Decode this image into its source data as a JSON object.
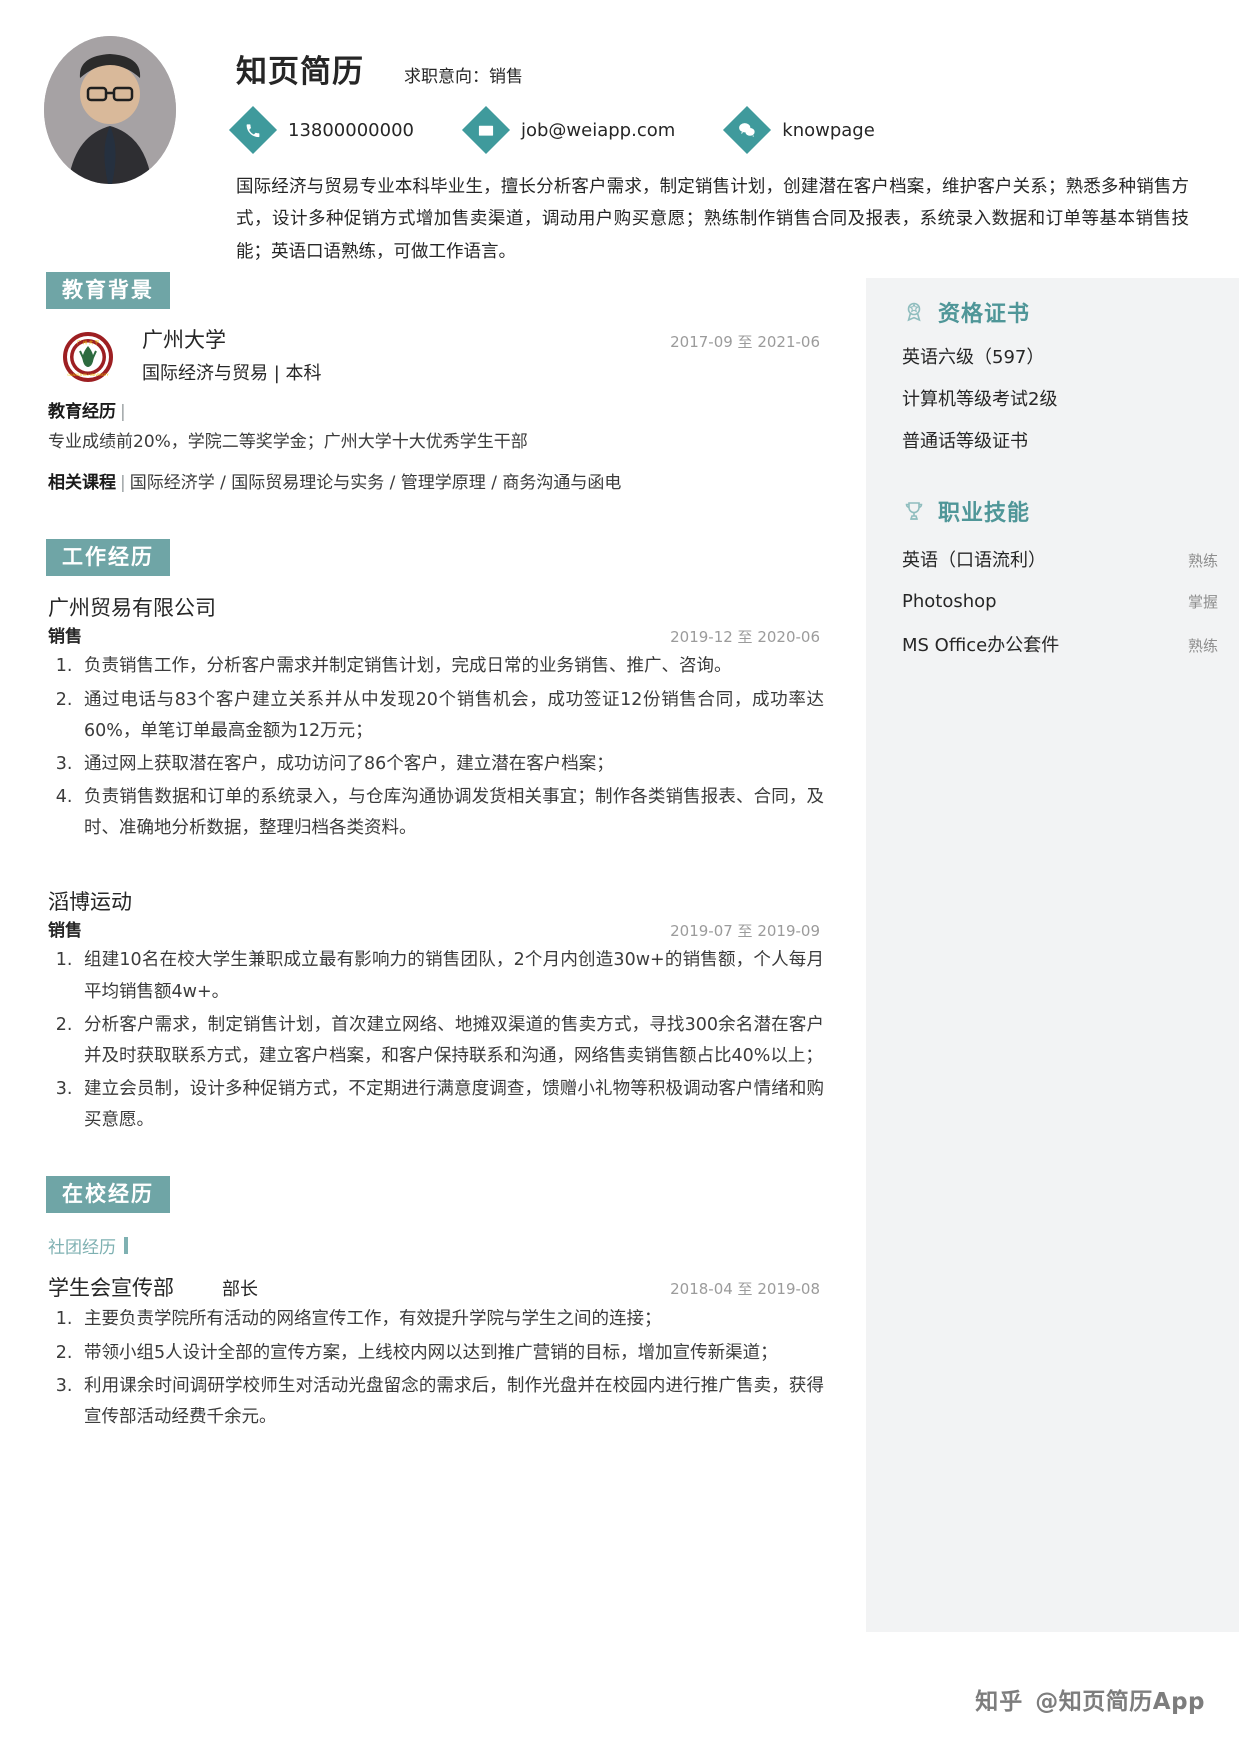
{
  "header": {
    "name": "知页简历",
    "objective": "求职意向：销售",
    "contacts": [
      {
        "icon": "phone-icon",
        "text": "13800000000"
      },
      {
        "icon": "mail-icon",
        "text": "job@weiapp.com"
      },
      {
        "icon": "wechat-icon",
        "text": "knowpage"
      }
    ],
    "summary": "国际经济与贸易专业本科毕业生，擅长分析客户需求，制定销售计划，创建潜在客户档案，维护客户关系；熟悉多种销售方式，设计多种促销方式增加售卖渠道，调动用户购买意愿；熟练制作销售合同及报表，系统录入数据和订单等基本销售技能；英语口语熟练，可做工作语言。"
  },
  "education": {
    "section_title": "教育背景",
    "school": "广州大学",
    "major": "国际经济与贸易 | 本科",
    "date": "2017-09 至 2021-06",
    "experience_label": "教育经历",
    "experience_text": "专业成绩前20%，学院二等奖学金；广州大学十大优秀学生干部",
    "courses_label": "相关课程",
    "courses_text": "国际经济学 / 国际贸易理论与实务 / 管理学原理 / 商务沟通与函电"
  },
  "work": {
    "section_title": "工作经历",
    "jobs": [
      {
        "company": "广州贸易有限公司",
        "role": "销售",
        "date": "2019-12 至 2020-06",
        "bullets": [
          "负责销售工作，分析客户需求并制定销售计划，完成日常的业务销售、推广、咨询。",
          "通过电话与83个客户建立关系并从中发现20个销售机会，成功签证12份销售合同，成功率达60%，单笔订单最高金额为12万元；",
          "通过网上获取潜在客户，成功访问了86个客户，建立潜在客户档案；",
          "负责销售数据和订单的系统录入，与仓库沟通协调发货相关事宜；制作各类销售报表、合同，及时、准确地分析数据，整理归档各类资料。"
        ]
      },
      {
        "company": "滔博运动",
        "role": "销售",
        "date": "2019-07 至 2019-09",
        "bullets": [
          "组建10名在校大学生兼职成立最有影响力的销售团队，2个月内创造30w+的销售额，个人每月平均销售额4w+。",
          "分析客户需求，制定销售计划，首次建立网络、地摊双渠道的售卖方式，寻找300余名潜在客户并及时获取联系方式，建立客户档案，和客户保持联系和沟通，网络售卖销售额占比40%以上；",
          "建立会员制，设计多种促销方式，不定期进行满意度调查，馈赠小礼物等积极调动客户情绪和购买意愿。"
        ]
      }
    ]
  },
  "campus": {
    "section_title": "在校经历",
    "sub_title": "社团经历",
    "club_name": "学生会宣传部",
    "club_role": "部长",
    "date": "2018-04 至 2019-08",
    "bullets": [
      "主要负责学院所有活动的网络宣传工作，有效提升学院与学生之间的连接；",
      "带领小组5人设计全部的宣传方案，上线校内网以达到推广营销的目标，增加宣传新渠道；",
      "利用课余时间调研学校师生对活动光盘留念的需求后，制作光盘并在校园内进行推广售卖，获得宣传部活动经费千余元。"
    ]
  },
  "sidebar": {
    "certificates": {
      "title": "资格证书",
      "icon": "medal-icon",
      "items": [
        "英语六级（597）",
        "计算机等级考试2级",
        "普通话等级证书"
      ]
    },
    "skills": {
      "title": "职业技能",
      "icon": "trophy-icon",
      "items": [
        {
          "name": "英语（口语流利）",
          "level": "熟练"
        },
        {
          "name": "Photoshop",
          "level": "掌握"
        },
        {
          "name": "MS Office办公套件",
          "level": "熟练"
        }
      ]
    }
  },
  "footer": {
    "logo": "知乎",
    "text": "@知页简历App"
  },
  "colors": {
    "accent": "#3f9a9c",
    "section_bg": "#6fa5a6",
    "sidebar_bg": "#f2f3f4",
    "sidebar_title": "#4f9698",
    "muted": "#9b9b9b"
  }
}
